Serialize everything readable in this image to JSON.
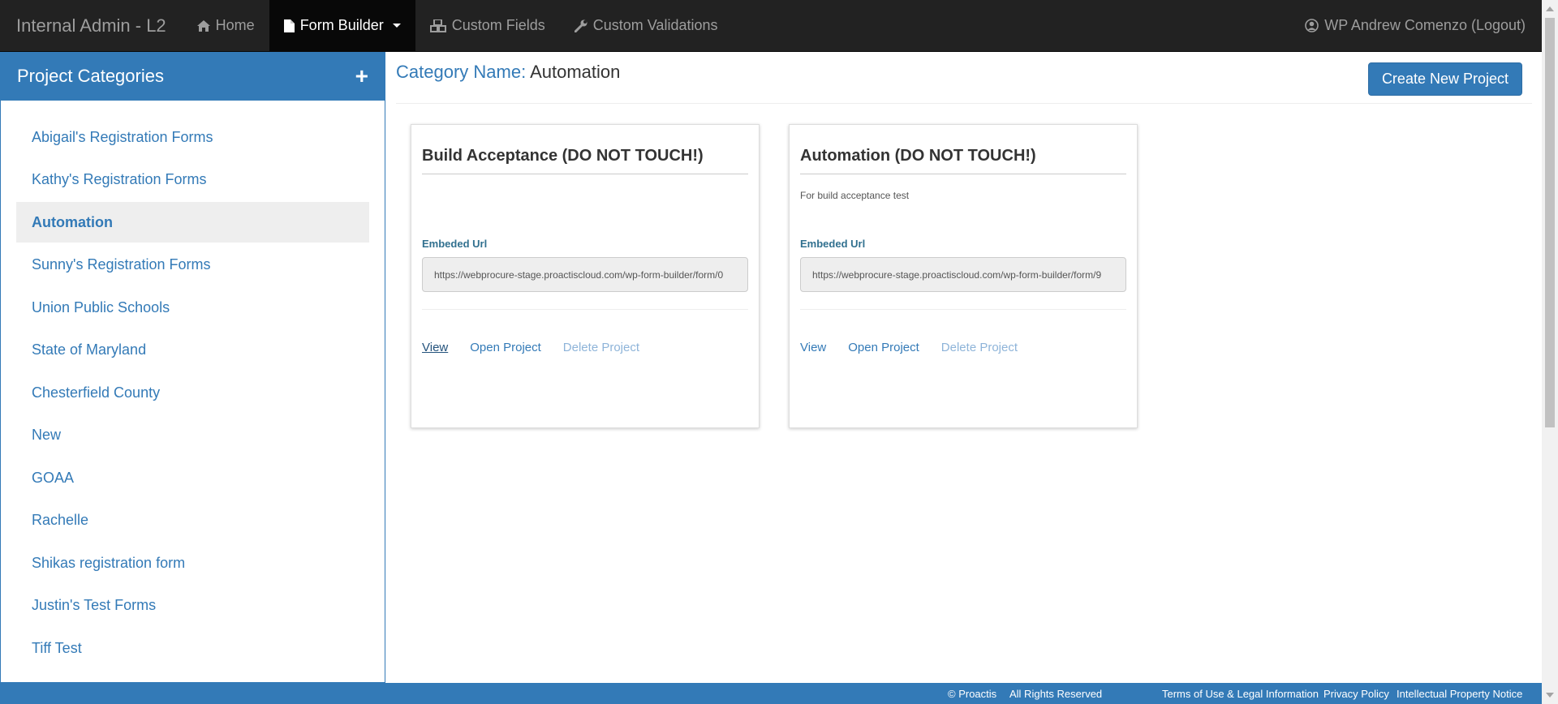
{
  "navbar": {
    "brand": "Internal Admin - L2",
    "items": [
      {
        "label": "Home",
        "icon": "home-icon"
      },
      {
        "label": "Form Builder",
        "icon": "file-icon"
      },
      {
        "label": "Custom Fields",
        "icon": "cubes-icon"
      },
      {
        "label": "Custom Validations",
        "icon": "wrench-icon"
      }
    ],
    "user": "WP Andrew Comenzo (Logout)"
  },
  "sidebar": {
    "title": "Project Categories",
    "add_icon": "plus-icon",
    "items": [
      "Abigail's Registration Forms",
      "Kathy's Registration Forms",
      "Automation",
      "Sunny's Registration Forms",
      "Union Public Schools",
      "State of Maryland",
      "Chesterfield County",
      "New",
      "GOAA",
      "Rachelle",
      "Shikas registration form",
      "Justin's Test Forms",
      "Tiff Test"
    ],
    "active": "Automation"
  },
  "main": {
    "category_label": "Category Name:",
    "category_name": "Automation",
    "create_button": "Create New Project",
    "cards": [
      {
        "title": "Build Acceptance (DO NOT TOUCH!)",
        "description": "",
        "url_label": "Embeded Url",
        "url": "https://webprocure-stage.proactiscloud.com/wp-form-builder/form/0",
        "actions": {
          "view": "View",
          "open": "Open Project",
          "delete": "Delete Project"
        }
      },
      {
        "title": "Automation (DO NOT TOUCH!)",
        "description": "For build acceptance test",
        "url_label": "Embeded Url",
        "url": "https://webprocure-stage.proactiscloud.com/wp-form-builder/form/9",
        "actions": {
          "view": "View",
          "open": "Open Project",
          "delete": "Delete Project"
        }
      }
    ]
  },
  "footer": {
    "copyright": "© Proactis",
    "rights": "All Rights Reserved",
    "terms": "Terms of Use & Legal Information",
    "privacy": "Privacy Policy",
    "ip": "Intellectual Property Notice"
  },
  "colors": {
    "primary": "#337ab7",
    "navbar": "#222222",
    "active_nav": "#080808"
  }
}
